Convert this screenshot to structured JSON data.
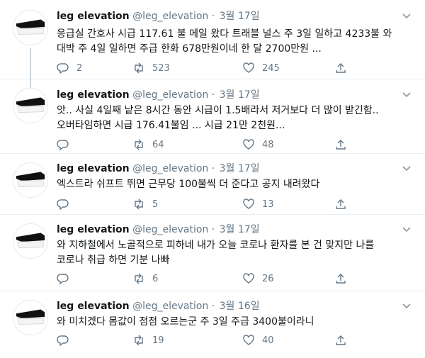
{
  "tweets": [
    {
      "name": "leg elevation",
      "handle": "@leg_elevation",
      "dot": "·",
      "date": "3월 17일",
      "text": "응급실 간호사 시급 117.61 불 메일 왔다 트래블 널스 주 3일 일하고 4233불 와 대박 주 4일 일하면 주급 한화 678만원이네 한 달 2700만원 ...",
      "replies": "2",
      "retweets": "523",
      "likes": "245"
    },
    {
      "name": "leg elevation",
      "handle": "@leg_elevation",
      "dot": "·",
      "date": "3월 17일",
      "text": "앗.. 사실 4일째 낱은 8시간 동안 시급이 1.5배라서 저거보다 더 많이 받긴함.. 오버타임하면 시급 176.41불임 ... 시급 21만 2천원...",
      "replies": "",
      "retweets": "64",
      "likes": "48"
    },
    {
      "name": "leg elevation",
      "handle": "@leg_elevation",
      "dot": "·",
      "date": "3월 17일",
      "text": "엑스트라 쉬프트 뛰면 근무당 100불씩 더 준다고 공지 내려왔다",
      "replies": "",
      "retweets": "5",
      "likes": "13"
    },
    {
      "name": "leg elevation",
      "handle": "@leg_elevation",
      "dot": "·",
      "date": "3월 17일",
      "text": "와 지하철에서 노골적으로 피하네 내가 오늘 코로나 환자를 본 건 맞지만 나를 코로나 취급 하면 기분 나빠",
      "replies": "",
      "retweets": "6",
      "likes": "26"
    },
    {
      "name": "leg elevation",
      "handle": "@leg_elevation",
      "dot": "·",
      "date": "3월 16일",
      "text": "와 미치겠다 몸값이 점점 오르는군 주 3일 주급 3400불이라니",
      "replies": "",
      "retweets": "19",
      "likes": "40"
    }
  ],
  "icons": {
    "reply": "reply-icon",
    "retweet": "retweet-icon",
    "like": "heart-icon",
    "share": "share-icon",
    "more": "chevron-down-icon",
    "avatar": "leg-elevation-avatar"
  },
  "colors": {
    "text": "#14171a",
    "secondary": "#657786",
    "divider": "#e6ecf0",
    "thread_line": "#ccd6dd"
  }
}
